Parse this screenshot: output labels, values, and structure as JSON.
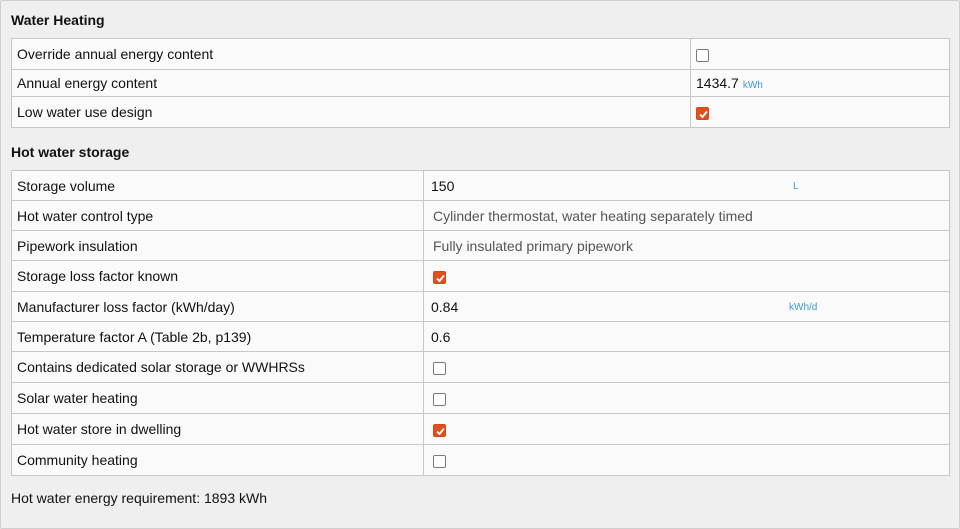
{
  "water_heating": {
    "title": "Water Heating",
    "rows": [
      {
        "label": "Override annual energy content",
        "type": "checkbox",
        "checked": false
      },
      {
        "label": "Annual energy content",
        "type": "value",
        "value": "1434.7",
        "unit": "kWh"
      },
      {
        "label": "Low water use design",
        "type": "checkbox",
        "checked": true
      }
    ]
  },
  "hot_water_storage": {
    "title": "Hot water storage",
    "rows": [
      {
        "label": "Storage volume",
        "type": "input",
        "value": "150",
        "unit": "L"
      },
      {
        "label": "Hot water control type",
        "type": "select",
        "value": "Cylinder thermostat, water heating separately timed"
      },
      {
        "label": "Pipework insulation",
        "type": "select",
        "value": "Fully insulated primary pipework"
      },
      {
        "label": "Storage loss factor known",
        "type": "checkbox",
        "checked": true
      },
      {
        "label": "Manufacturer loss factor (kWh/day)",
        "type": "input",
        "value": "0.84",
        "unit": "kWh/d"
      },
      {
        "label": "Temperature factor A (Table 2b, p139)",
        "type": "input",
        "value": "0.6"
      },
      {
        "label": "Contains dedicated solar storage or WWHRSs",
        "type": "checkbox",
        "checked": false
      },
      {
        "label": "Solar water heating",
        "type": "checkbox",
        "checked": false
      },
      {
        "label": "Hot water store in dwelling",
        "type": "checkbox",
        "checked": true
      },
      {
        "label": "Community heating",
        "type": "checkbox",
        "checked": false
      }
    ]
  },
  "footer": {
    "requirement_text": "Hot water energy requirement: 1893 kWh"
  },
  "colors": {
    "checkbox_checked": "#e0501c",
    "unit_text": "#3a9ad9",
    "background": "#efefef"
  }
}
